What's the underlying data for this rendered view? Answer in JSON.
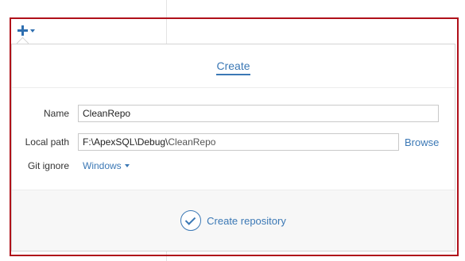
{
  "toolbar": {
    "add_icon": "plus-icon",
    "add_menu_icon": "caret-down-icon"
  },
  "dialog": {
    "tab_label": "Create",
    "fields": {
      "name_label": "Name",
      "name_value": "CleanRepo",
      "local_path_label": "Local path",
      "local_path_base": "F:\\ApexSQL\\Debug\\",
      "local_path_name": "CleanRepo",
      "browse_label": "Browse",
      "gitignore_label": "Git ignore",
      "gitignore_value": "Windows"
    },
    "create_button_label": "Create repository"
  },
  "colors": {
    "accent": "#3b78b5",
    "highlight_frame": "#b0101a",
    "footer_bg": "#f7f7f7"
  }
}
